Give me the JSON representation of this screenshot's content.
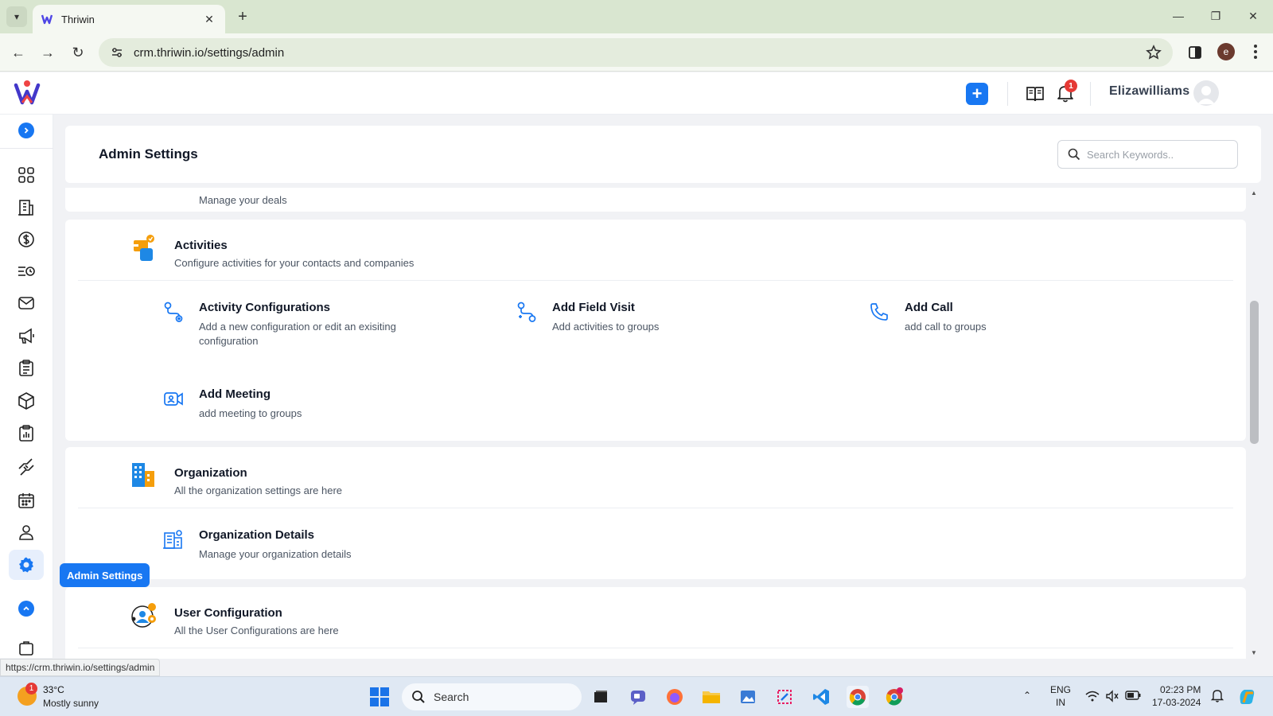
{
  "browser": {
    "tab_title": "Thriwin",
    "url": "crm.thriwin.io/settings/admin",
    "profile_initial": "e"
  },
  "header": {
    "username": "Elizawilliams",
    "notification_count": "1"
  },
  "sidebar": {
    "items": [
      "dashboard-icon",
      "building-icon",
      "dollar-icon",
      "activity-list-icon",
      "mail-icon",
      "megaphone-icon",
      "checklist-icon",
      "box-icon",
      "report-icon",
      "handshake-icon",
      "calendar-icon",
      "user-icon",
      "gear-icon"
    ],
    "tooltip": "Admin Settings"
  },
  "page": {
    "title": "Admin Settings",
    "search_placeholder": "Search Keywords.."
  },
  "sections": {
    "deals_partial_sub": "Manage your deals",
    "activities": {
      "title": "Activities",
      "subtitle": "Configure activities for your contacts and companies",
      "items": [
        {
          "title": "Activity Configurations",
          "desc": "Add a new configuration or edit an exisiting configuration"
        },
        {
          "title": "Add Field Visit",
          "desc": "Add activities to groups"
        },
        {
          "title": "Add Call",
          "desc": "add call to groups"
        },
        {
          "title": "Add Meeting",
          "desc": "add meeting to groups"
        }
      ]
    },
    "organization": {
      "title": "Organization",
      "subtitle": "All the organization settings are here",
      "items": [
        {
          "title": "Organization Details",
          "desc": "Manage your organization details"
        }
      ]
    },
    "user_configuration": {
      "title": "User Configuration",
      "subtitle": "All the User Configurations are here"
    }
  },
  "status_bar_url": "https://crm.thriwin.io/settings/admin",
  "taskbar": {
    "weather_temp": "33°C",
    "weather_desc": "Mostly sunny",
    "weather_badge": "1",
    "search_label": "Search",
    "lang_line1": "ENG",
    "lang_line2": "IN",
    "time": "02:23 PM",
    "date": "17-03-2024"
  },
  "colors": {
    "accent": "#1877f2",
    "badge": "#e53935"
  }
}
